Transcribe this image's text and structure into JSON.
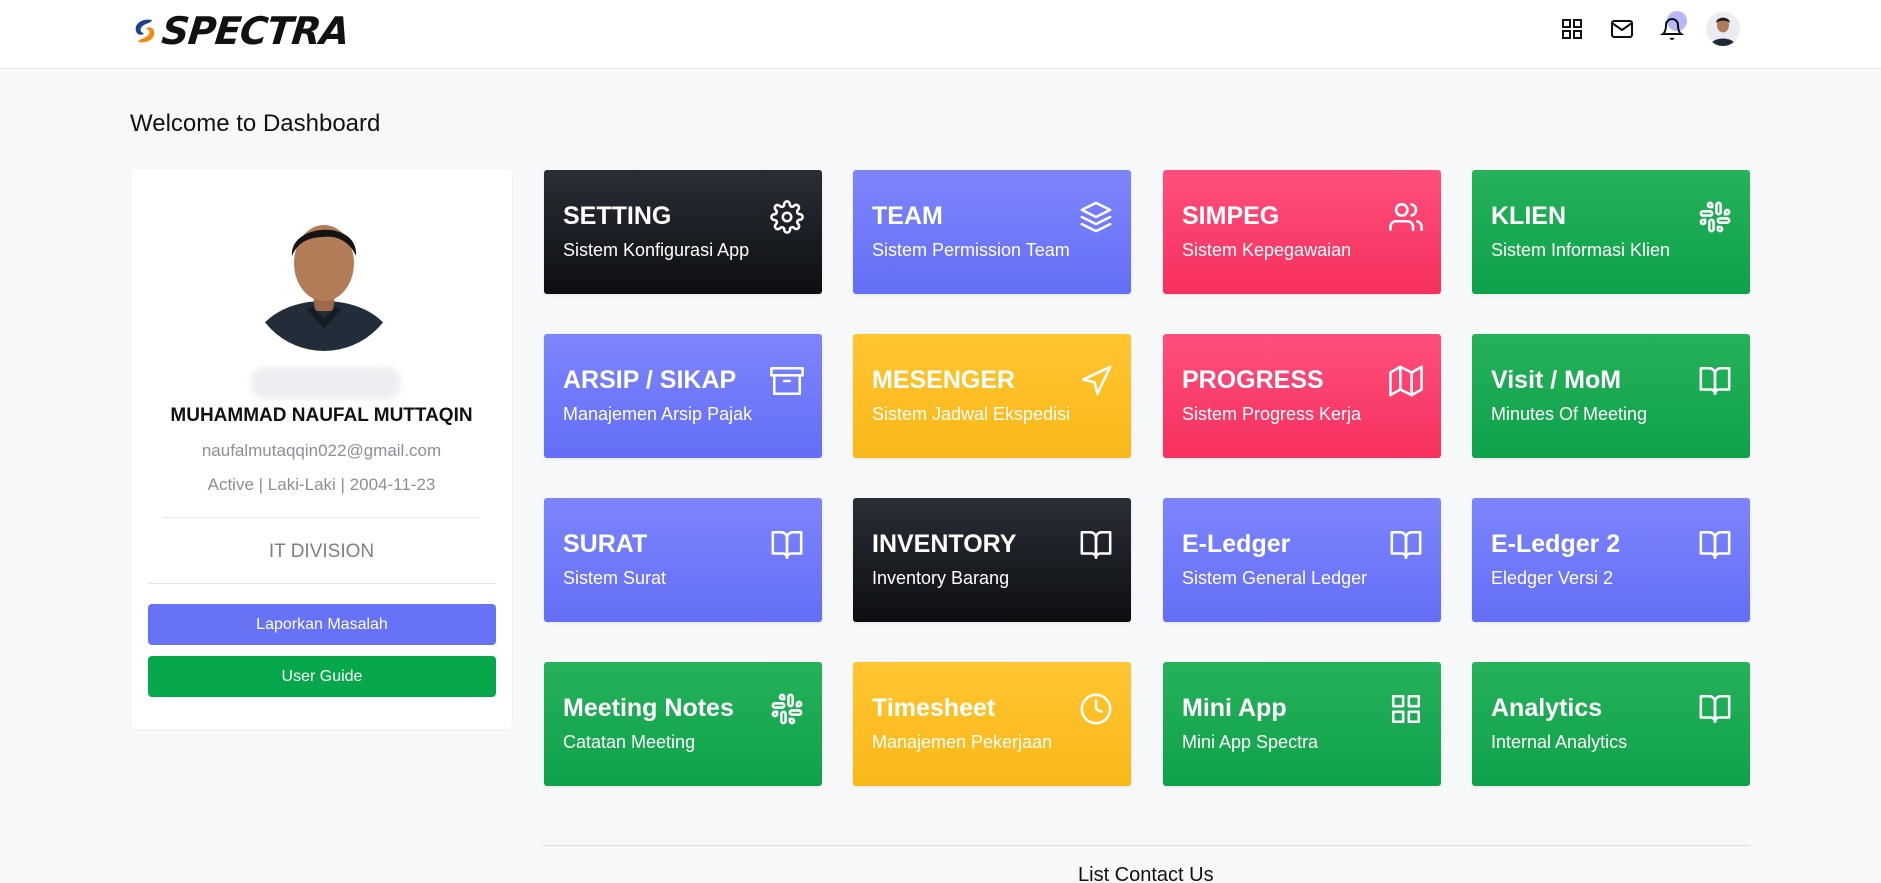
{
  "header": {
    "logo_text": "SPECTRA",
    "icons": [
      "apps-grid-icon",
      "mail-icon",
      "bell-icon",
      "user-avatar"
    ]
  },
  "welcome_title": "Welcome to Dashboard",
  "profile": {
    "name": "MUHAMMAD NAUFAL MUTTAQIN",
    "email": "naufalmutaqqin022@gmail.com",
    "status_line": "Active | Laki-Laki | 2004-11-23",
    "division": "IT DIVISION",
    "report_button": "Laporkan Masalah",
    "guide_button": "User Guide"
  },
  "tiles": [
    {
      "title": "SETTING",
      "subtitle": "Sistem Konfigurasi App",
      "icon": "gear-icon",
      "color": "#1a1d22"
    },
    {
      "title": "TEAM",
      "subtitle": "Sistem Permission Team",
      "icon": "layers-icon",
      "color": "#6f79f9"
    },
    {
      "title": "SIMPEG",
      "subtitle": "Sistem Kepegawaian",
      "icon": "users-icon",
      "color": "#fb3f6d"
    },
    {
      "title": "KLIEN",
      "subtitle": "Sistem Informasi Klien",
      "icon": "slack-icon",
      "color": "#18aa52"
    },
    {
      "title": "ARSIP / SIKAP",
      "subtitle": "Manajemen Arsip Pajak",
      "icon": "archive-icon",
      "color": "#6f79f9"
    },
    {
      "title": "MESENGER",
      "subtitle": "Sistem Jadwal Ekspedisi",
      "icon": "send-icon",
      "color": "#fcbe24"
    },
    {
      "title": "PROGRESS",
      "subtitle": "Sistem Progress Kerja",
      "icon": "map-icon",
      "color": "#fb3f6d"
    },
    {
      "title": "Visit / MoM",
      "subtitle": "Minutes Of Meeting",
      "icon": "book-open-icon",
      "color": "#18aa52"
    },
    {
      "title": "SURAT",
      "subtitle": "Sistem Surat",
      "icon": "book-open-icon",
      "color": "#6f79f9"
    },
    {
      "title": "INVENTORY",
      "subtitle": "Inventory Barang",
      "icon": "book-open-icon",
      "color": "#1a1d22"
    },
    {
      "title": "E-Ledger",
      "subtitle": "Sistem General Ledger",
      "icon": "book-open-icon",
      "color": "#6f79f9"
    },
    {
      "title": "E-Ledger 2",
      "subtitle": "Eledger Versi 2",
      "icon": "book-open-icon",
      "color": "#6f79f9"
    },
    {
      "title": "Meeting Notes",
      "subtitle": "Catatan Meeting",
      "icon": "slack-icon",
      "color": "#18aa52"
    },
    {
      "title": "Timesheet",
      "subtitle": "Manajemen Pekerjaan",
      "icon": "clock-icon",
      "color": "#fcbe24"
    },
    {
      "title": "Mini App",
      "subtitle": "Mini App Spectra",
      "icon": "apps-grid-icon",
      "color": "#18aa52"
    },
    {
      "title": "Analytics",
      "subtitle": "Internal Analytics",
      "icon": "book-open-icon",
      "color": "#18aa52"
    }
  ],
  "contact_section_title": "List Contact Us"
}
